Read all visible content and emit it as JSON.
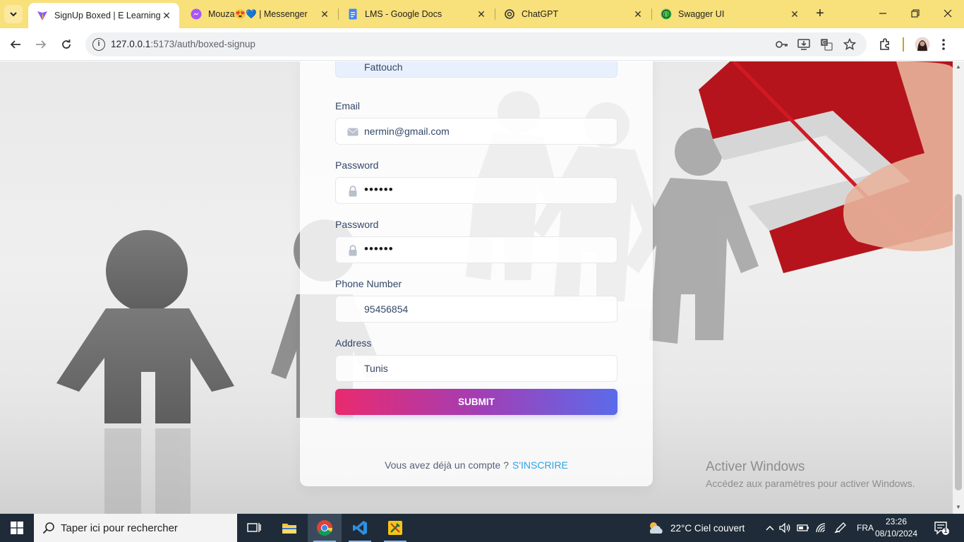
{
  "browser": {
    "tabs": [
      {
        "title": "SignUp Boxed | E Learning",
        "active": true,
        "favicon": "vite-icon"
      },
      {
        "title": "Mouza😍💙 | Messenger",
        "active": false,
        "favicon": "messenger-icon"
      },
      {
        "title": "LMS - Google Docs",
        "active": false,
        "favicon": "google-docs-icon"
      },
      {
        "title": "ChatGPT",
        "active": false,
        "favicon": "chatgpt-icon"
      },
      {
        "title": "Swagger UI",
        "active": false,
        "favicon": "swagger-icon"
      }
    ],
    "url_host": "127.0.0.1",
    "url_rest": ":5173/auth/boxed-signup"
  },
  "form": {
    "lastname_value": "Fattouch",
    "email_label": "Email",
    "email_value": "nermin@gmail.com",
    "password_label": "Password",
    "password_value": "••••••",
    "confirm_label": "Password",
    "confirm_value": "••••••",
    "phone_label": "Phone Number",
    "phone_value": "95456854",
    "address_label": "Address",
    "address_value": "Tunis",
    "submit_label": "SUBMIT",
    "have_account_text": "Vous avez déjà un compte ?",
    "signin_link": "S'INSCRIRE"
  },
  "watermark": {
    "title": "Activer Windows",
    "subtitle": "Accédez aux paramètres pour activer Windows."
  },
  "taskbar": {
    "search_placeholder": "Taper ici pour rechercher",
    "weather": "22°C  Ciel couvert",
    "language": "FRA",
    "time": "23:26",
    "date": "08/10/2024",
    "notification_count": "1"
  },
  "colors": {
    "tabbar": "#f8e07a",
    "submit_start": "#ea2a6e",
    "submit_end": "#5b6bea",
    "link": "#2ba4e6",
    "taskbar": "#1f2b38"
  }
}
